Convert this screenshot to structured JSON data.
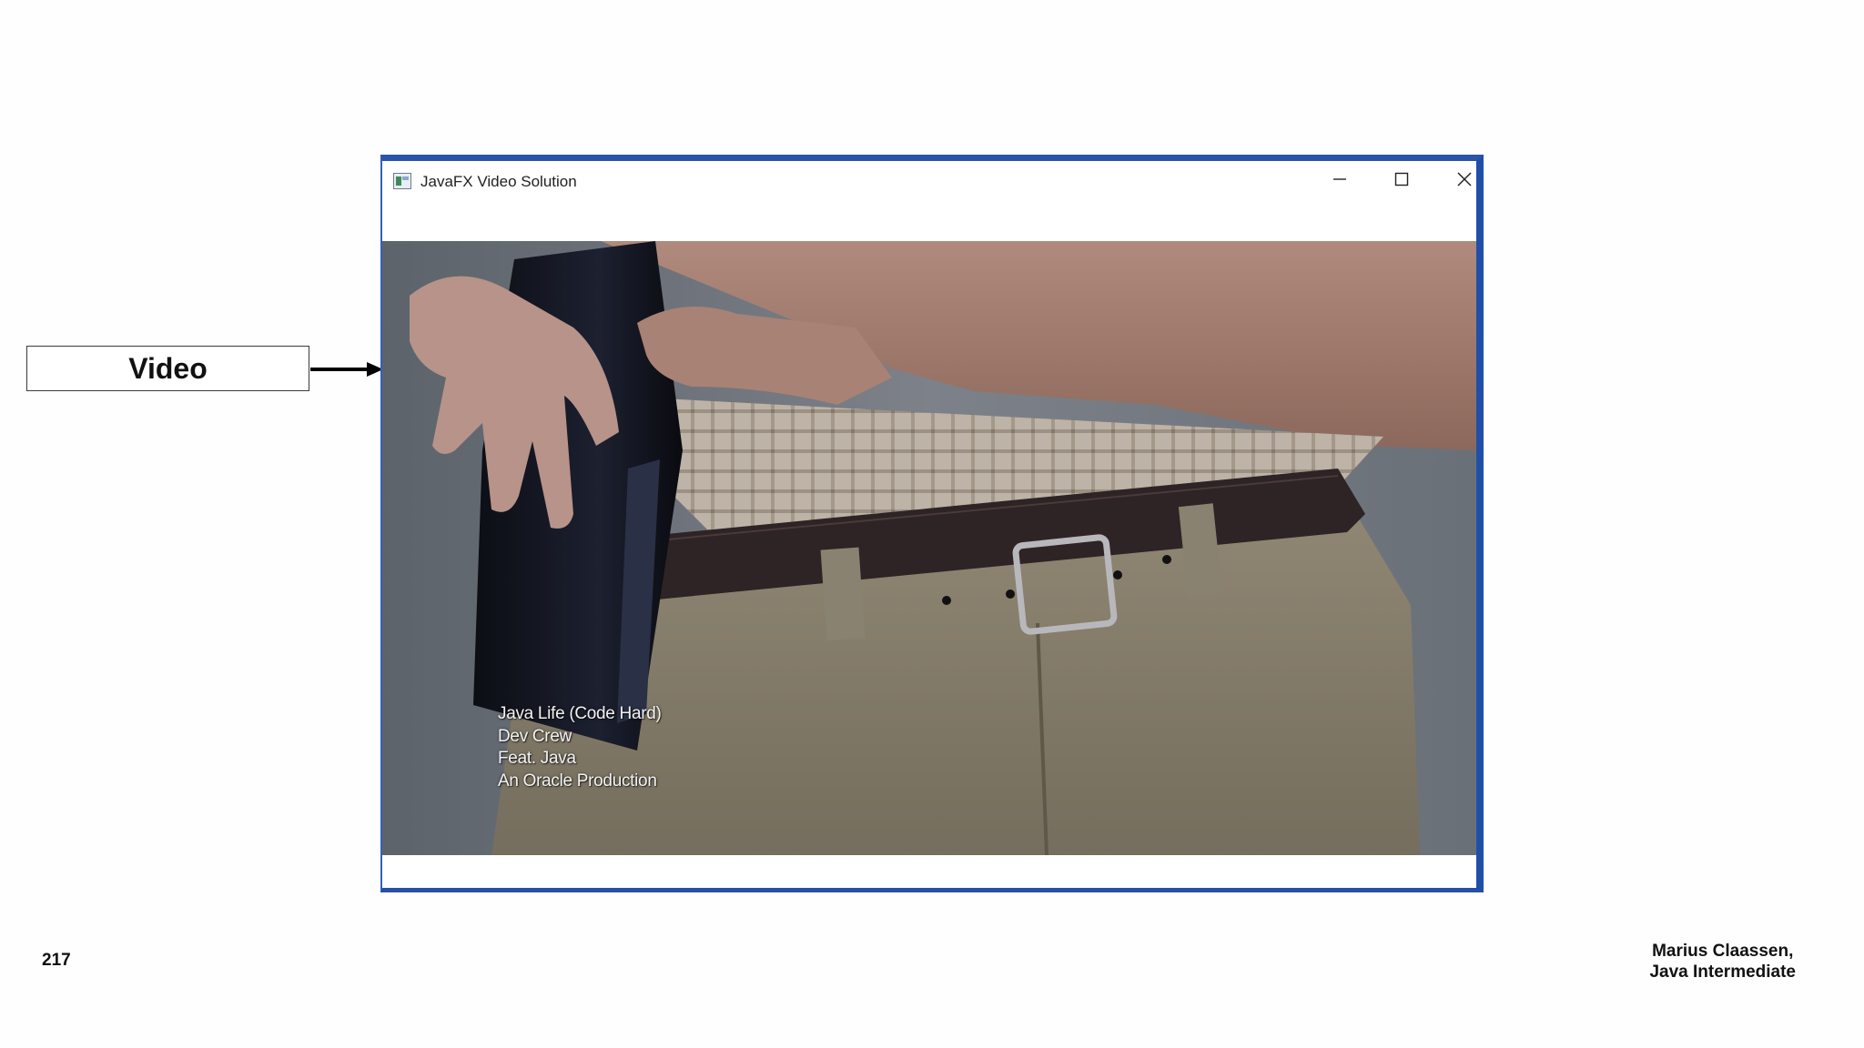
{
  "callout": {
    "label": "Video"
  },
  "window": {
    "title": "JavaFX Video Solution",
    "controls": {
      "minimize": "minimize-icon",
      "maximize": "maximize-icon",
      "close": "close-icon"
    },
    "border_color": "#2a55a8"
  },
  "video": {
    "credits": [
      "Java Life (Code Hard)",
      "Dev Crew",
      "Feat. Java",
      "An Oracle Production"
    ]
  },
  "footer": {
    "page_number": "217",
    "author_line1": "Marius Claassen,",
    "author_line2": "Java Intermediate"
  }
}
